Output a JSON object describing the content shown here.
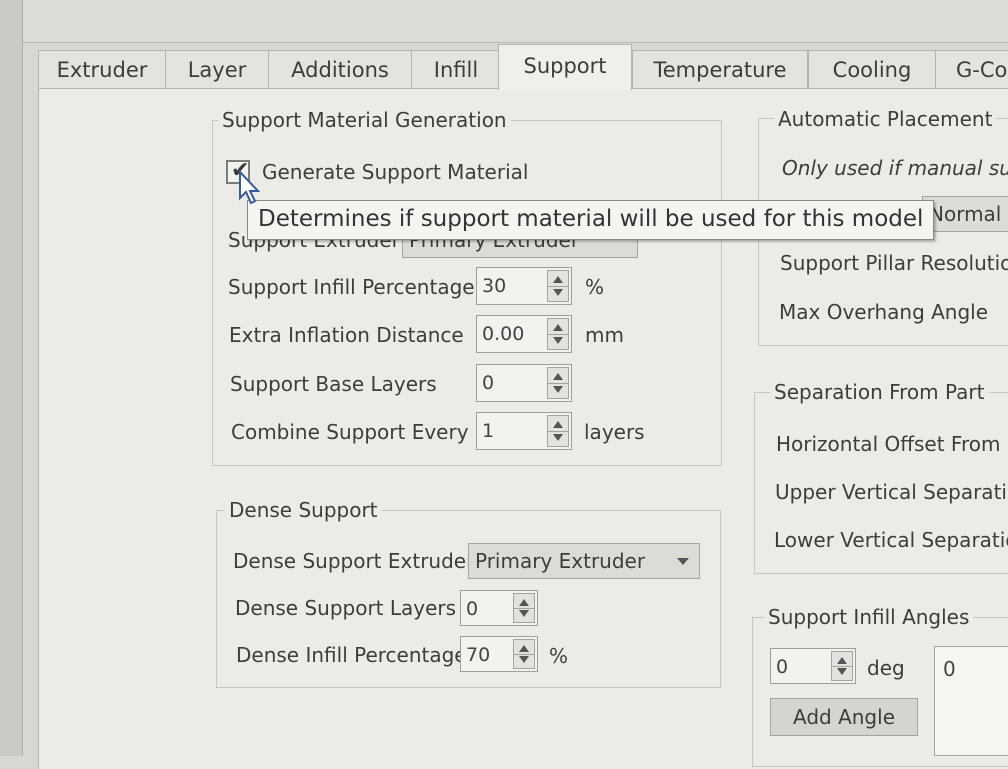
{
  "tabs": [
    "Extruder",
    "Layer",
    "Additions",
    "Infill",
    "Support",
    "Temperature",
    "Cooling",
    "G-Co"
  ],
  "support_gen": {
    "title": "Support Material Generation",
    "generate_label": "Generate Support Material",
    "generate_checked": true,
    "extruder_label": "Support Extruder",
    "extruder_value": "Primary Extruder",
    "infill_pct_label": "Support Infill Percentage",
    "infill_pct_value": "30",
    "infill_pct_unit": "%",
    "inflation_label": "Extra Inflation Distance",
    "inflation_value": "0.00",
    "inflation_unit": "mm",
    "base_layers_label": "Support Base Layers",
    "base_layers_value": "0",
    "combine_label": "Combine Support Every",
    "combine_value": "1",
    "combine_unit": "layers"
  },
  "tooltip": "Determines if support material will be used for this model",
  "dense": {
    "title": "Dense Support",
    "extruder_label": "Dense Support Extruder",
    "extruder_value": "Primary Extruder",
    "layers_label": "Dense Support Layers",
    "layers_value": "0",
    "infill_label": "Dense Infill Percentage",
    "infill_value": "70",
    "infill_unit": "%"
  },
  "placement": {
    "title": "Automatic Placement",
    "note": "Only used if manual su",
    "type_value": "Normal",
    "pillar_label": "Support Pillar Resolutio",
    "overhang_label": "Max Overhang Angle"
  },
  "separation": {
    "title": "Separation From Part",
    "horizontal_label": "Horizontal Offset From P",
    "upper_label": "Upper Vertical Separatio",
    "lower_label": "Lower Vertical Separatio"
  },
  "angles": {
    "title": "Support Infill Angles",
    "angle_value": "0",
    "angle_unit": "deg",
    "add_label": "Add Angle",
    "list_first": "0"
  },
  "colors": {
    "panel": "#ebebe7",
    "tooltip_bg": "#f4f4f0",
    "border": "#c6c7c3"
  },
  "icons": {
    "cursor": "pointer-cursor-icon",
    "check": "checkmark-icon",
    "dropdown": "chevron-down-icon"
  }
}
